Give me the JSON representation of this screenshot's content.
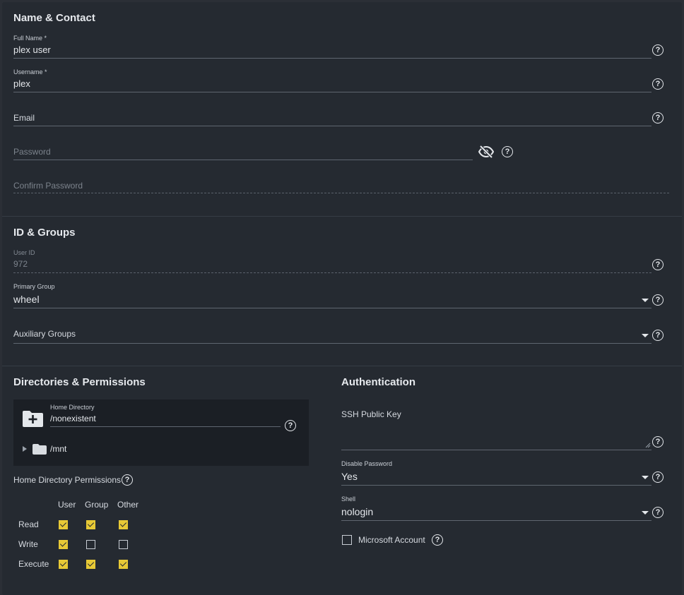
{
  "name_contact": {
    "title": "Name & Contact",
    "full_name_label": "Full Name *",
    "full_name_value": "plex user",
    "username_label": "Username *",
    "username_value": "plex",
    "email_label": "Email",
    "password_placeholder": "Password",
    "confirm_password_placeholder": "Confirm Password"
  },
  "id_groups": {
    "title": "ID & Groups",
    "user_id_label": "User ID",
    "user_id_value": "972",
    "primary_group_label": "Primary Group",
    "primary_group_value": "wheel",
    "aux_groups_label": "Auxiliary Groups"
  },
  "directories": {
    "title": "Directories & Permissions",
    "home_dir_label": "Home Directory",
    "home_dir_value": "/nonexistent",
    "tree_node": "/mnt",
    "permissions_label": "Home Directory Permissions",
    "columns": [
      "User",
      "Group",
      "Other"
    ],
    "rows": [
      {
        "label": "Read",
        "values": [
          true,
          true,
          true
        ]
      },
      {
        "label": "Write",
        "values": [
          true,
          false,
          false
        ]
      },
      {
        "label": "Execute",
        "values": [
          true,
          true,
          true
        ]
      }
    ]
  },
  "authentication": {
    "title": "Authentication",
    "ssh_key_label": "SSH Public Key",
    "disable_password_label": "Disable Password",
    "disable_password_value": "Yes",
    "shell_label": "Shell",
    "shell_value": "nologin",
    "microsoft_account_label": "Microsoft Account",
    "microsoft_account_checked": false
  },
  "colors": {
    "background": "#252a31",
    "accent_checkbox": "#e7c936",
    "panel": "#1b1f25"
  },
  "icons": {
    "help": "help-circle-icon",
    "visibility": "eye-off-icon",
    "folder_add": "folder-plus-icon",
    "folder": "folder-icon",
    "expand": "triangle-right-icon",
    "dropdown": "caret-down-icon"
  }
}
